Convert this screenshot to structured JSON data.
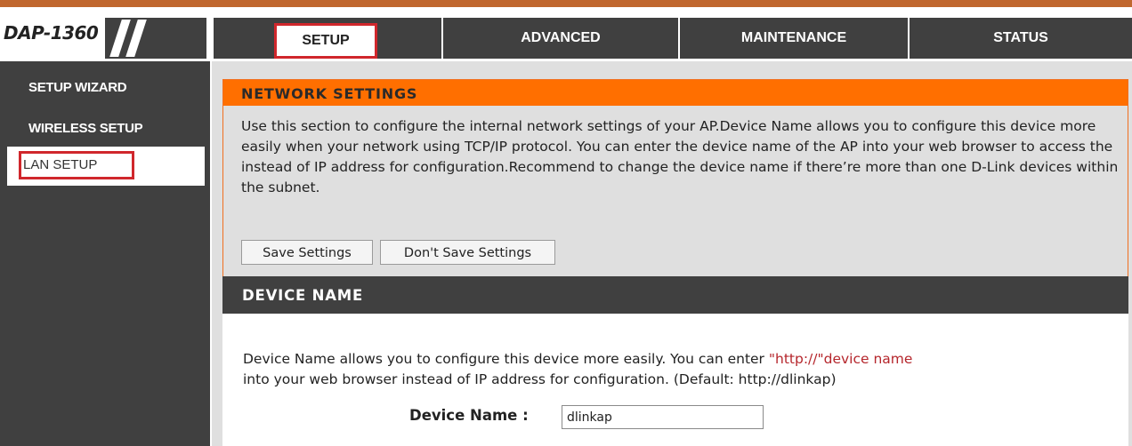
{
  "header": {
    "model": "DAP-1360"
  },
  "tabs": [
    {
      "label": "SETUP",
      "active": true
    },
    {
      "label": "ADVANCED"
    },
    {
      "label": "MAINTENANCE"
    },
    {
      "label": "STATUS"
    }
  ],
  "sidebar": {
    "items": [
      {
        "label": "SETUP WIZARD"
      },
      {
        "label": "WIRELESS SETUP"
      },
      {
        "label": "LAN SETUP",
        "active": true
      }
    ]
  },
  "network_settings": {
    "title": "NETWORK SETTINGS",
    "description": "Use this section to configure the internal network settings of your AP.Device Name allows you to configure this device more easily when your network using TCP/IP protocol. You can enter the device name of the AP into your web browser to access the instead of IP address for configuration.Recommend to change the device name if there’re more than one D-Link devices within the subnet.",
    "save_label": "Save Settings",
    "dont_save_label": "Don't Save Settings"
  },
  "device_name": {
    "title": "DEVICE NAME",
    "desc_before": "Device Name allows you to configure this device more easily. You can enter ",
    "desc_link": "\"http://\"device name",
    "desc_after": " into your web browser instead of IP address for configuration. (Default: http://dlinkap)",
    "field_label": "Device Name :",
    "field_value": "dlinkap"
  },
  "colors": {
    "accent_orange": "#ff6f00",
    "dark_gray": "#404040",
    "highlight_red": "#d0272c"
  }
}
